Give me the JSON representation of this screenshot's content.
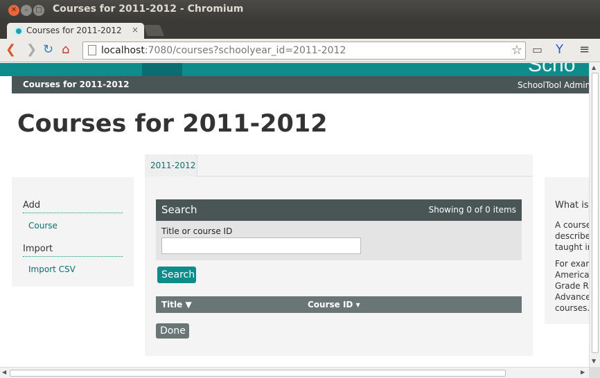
{
  "window": {
    "title": "Courses for 2011-2012 - Chromium"
  },
  "tab": {
    "title": "Courses for 2011-2012",
    "close": "×"
  },
  "address": {
    "host": "localhost",
    "rest": ":7080/courses?schoolyear_id=2011-2012"
  },
  "header": {
    "brand": "Scho",
    "breadcrumb": "Courses for 2011-2012",
    "right_link": "SchoolTool Adminis"
  },
  "page": {
    "title": "Courses for 2011-2012"
  },
  "sidebar": {
    "sections": [
      {
        "heading": "Add",
        "links": [
          "Course"
        ]
      },
      {
        "heading": "Import",
        "links": [
          "Import CSV"
        ]
      }
    ]
  },
  "tabs": [
    "2011-2012"
  ],
  "search": {
    "title": "Search",
    "count": "Showing 0 of 0 items",
    "field_label": "Title or course ID",
    "field_value": "",
    "button": "Search"
  },
  "table": {
    "columns": [
      "Title ▼",
      "Course ID ▾"
    ]
  },
  "done_button": "Done",
  "help": {
    "heading": "What is",
    "para1": [
      "A course",
      "describes",
      "taught in"
    ],
    "para2": [
      "For exam",
      "American",
      "Grade Re",
      "Advanced",
      "courses."
    ]
  }
}
